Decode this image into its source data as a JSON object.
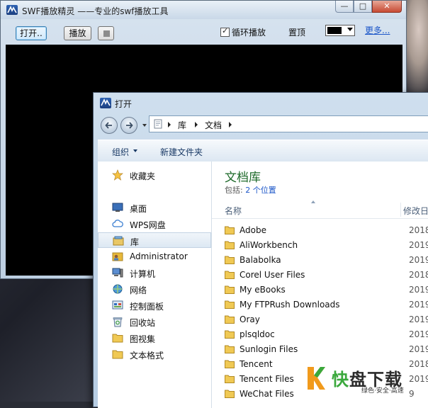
{
  "swf_window": {
    "title": "SWF播放精灵 ——专业的swf播放工具",
    "caption_min": "—",
    "caption_max": "□",
    "caption_close": "✕",
    "open_button": "打开..",
    "play_button": "播放",
    "loop_checkbox_label": "循环播放",
    "loop_checked": true,
    "pin_label": "置顶",
    "bg_color": "#000000",
    "more_link": "更多..."
  },
  "open_dialog": {
    "title": "打开",
    "breadcrumb": [
      "库",
      "文档"
    ],
    "command_bar": {
      "organize": "组织",
      "new_folder": "新建文件夹"
    },
    "nav": [
      {
        "label": "收藏夹",
        "icon": "favorites-star-icon"
      },
      {
        "label": "桌面",
        "icon": "desktop-icon"
      },
      {
        "label": "WPS网盘",
        "icon": "cloud-icon"
      },
      {
        "label": "库",
        "icon": "library-icon",
        "selected": true
      },
      {
        "label": "Administrator",
        "icon": "user-folder-icon"
      },
      {
        "label": "计算机",
        "icon": "computer-icon"
      },
      {
        "label": "网络",
        "icon": "network-icon"
      },
      {
        "label": "控制面板",
        "icon": "control-panel-icon"
      },
      {
        "label": "回收站",
        "icon": "recycle-bin-icon"
      },
      {
        "label": "图视集",
        "icon": "folder-icon"
      },
      {
        "label": "文本格式",
        "icon": "folder-icon"
      }
    ],
    "library_title": "文档库",
    "library_includes": "包括:",
    "library_locations": "2 个位置",
    "columns": {
      "name": "名称",
      "date": "修改日"
    },
    "files": [
      {
        "name": "Adobe",
        "date": "2018"
      },
      {
        "name": "AliWorkbench",
        "date": "2019"
      },
      {
        "name": "Balabolka",
        "date": "2019"
      },
      {
        "name": "Corel User Files",
        "date": "2018"
      },
      {
        "name": "My eBooks",
        "date": "2019"
      },
      {
        "name": "My FTPRush Downloads",
        "date": "2019"
      },
      {
        "name": "Oray",
        "date": "2019"
      },
      {
        "name": "plsqldoc",
        "date": "2019"
      },
      {
        "name": "Sunlogin Files",
        "date": "2019"
      },
      {
        "name": "Tencent",
        "date": "2018"
      },
      {
        "name": "Tencent Files",
        "date": "2019"
      },
      {
        "name": "WeChat Files",
        "date": "9"
      }
    ]
  },
  "watermark": {
    "main_dark": "快",
    "main_rest": "盘下载",
    "tagline": "绿色·安全·高速"
  },
  "colors": {
    "accent_blue": "#1a55c8",
    "library_title_green": "#1e6a2a",
    "folder_yellow": "#e8b93a",
    "watermark_green": "#3aa83c",
    "watermark_orange": "#f19a1c"
  }
}
